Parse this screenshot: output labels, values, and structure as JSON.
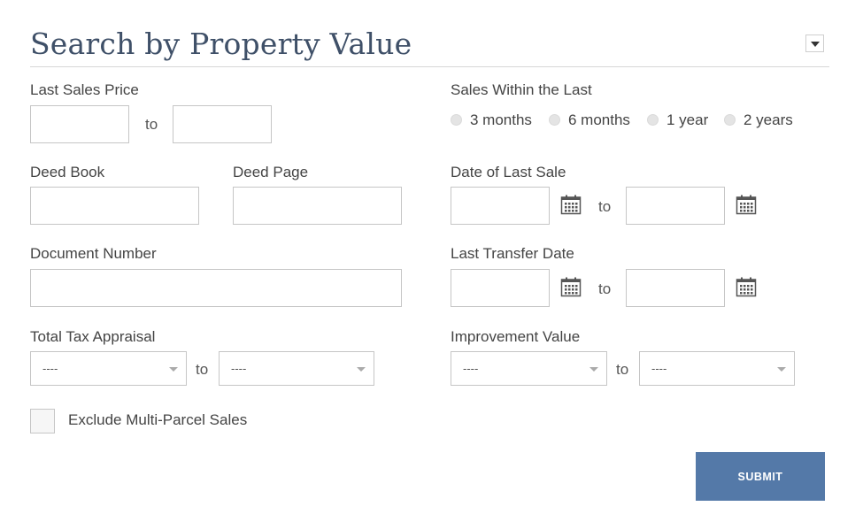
{
  "header": {
    "title": "Search by Property Value",
    "collapse_icon": "chevron-down-icon"
  },
  "last_sales_price": {
    "label": "Last Sales Price",
    "from_value": "",
    "to_label": "to",
    "to_value": ""
  },
  "sales_within": {
    "label": "Sales Within the Last",
    "options": [
      "3 months",
      "6 months",
      "1 year",
      "2 years"
    ]
  },
  "deed_book": {
    "label": "Deed Book",
    "value": ""
  },
  "deed_page": {
    "label": "Deed Page",
    "value": ""
  },
  "date_of_last_sale": {
    "label": "Date of Last Sale",
    "to_label": "to",
    "from_value": "",
    "to_value": "",
    "icon": "calendar-icon"
  },
  "document_number": {
    "label": "Document Number",
    "value": ""
  },
  "last_transfer_date": {
    "label": "Last Transfer Date",
    "to_label": "to",
    "from_value": "",
    "to_value": "",
    "icon": "calendar-icon"
  },
  "total_tax_appraisal": {
    "label": "Total Tax Appraisal",
    "from_selected": "----",
    "to_label": "to",
    "to_selected": "----"
  },
  "improvement_value": {
    "label": "Improvement Value",
    "from_selected": "----",
    "to_label": "to",
    "to_selected": "----"
  },
  "exclude_multi_parcel": {
    "label": "Exclude Multi-Parcel Sales",
    "checked": false
  },
  "submit": {
    "label": "SUBMIT",
    "color": "#5479a8"
  },
  "colors": {
    "title": "#3f5068",
    "border": "#c6c6c6",
    "accent": "#5479a8"
  }
}
